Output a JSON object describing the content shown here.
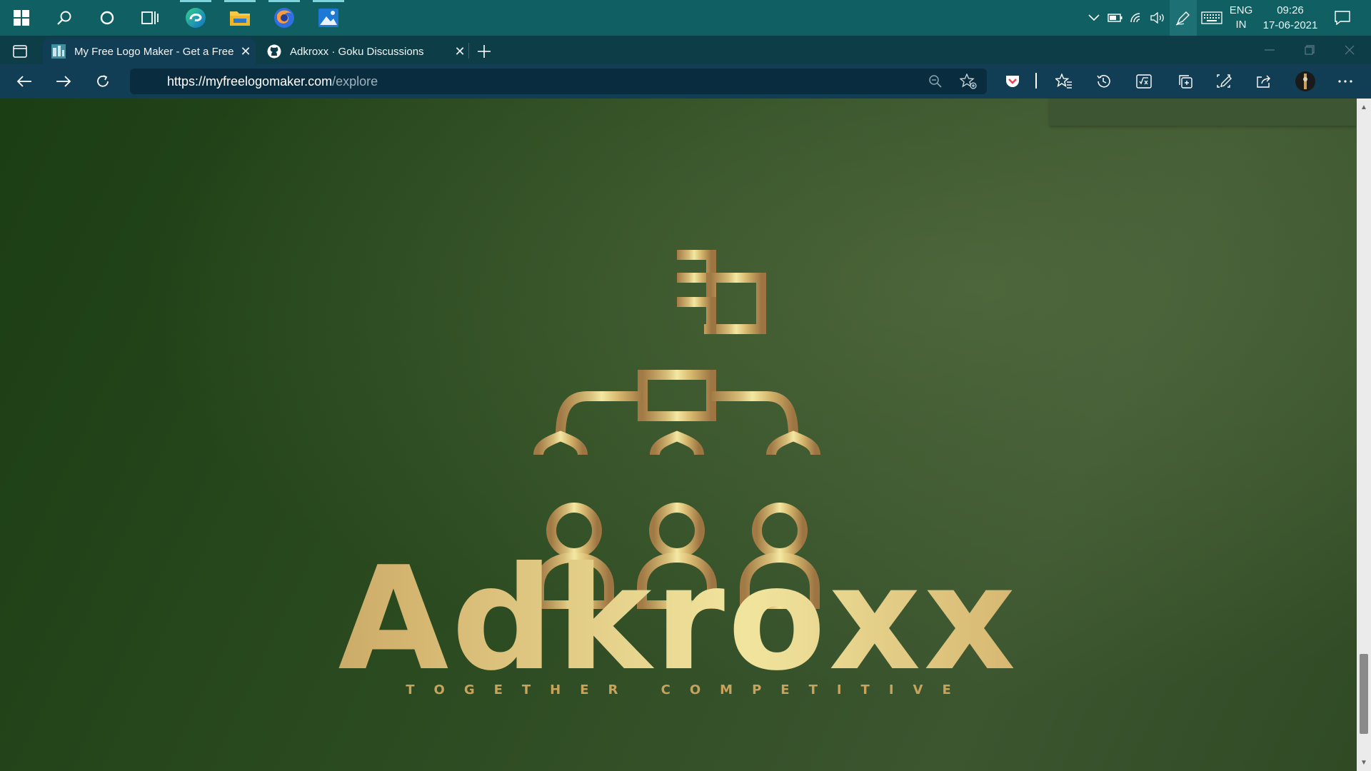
{
  "taskbar": {
    "icons": [
      "windows-start-icon",
      "search-icon",
      "cortana-icon",
      "task-view-icon",
      "edge-icon",
      "file-explorer-icon",
      "firefox-icon",
      "photos-icon"
    ],
    "tray": {
      "language_line1": "ENG",
      "language_line2": "IN",
      "time": "09:26",
      "date": "17-06-2021"
    }
  },
  "browser": {
    "tabs": [
      {
        "title": "My Free Logo Maker - Get a Free Logo",
        "favicon": "myfreelogomaker-favicon",
        "active": true
      },
      {
        "title": "Adkroxx · Goku Discussions",
        "favicon": "github-icon",
        "active": false
      }
    ],
    "address": {
      "domain": "https://myfreelogomaker.com",
      "path": "/explore"
    }
  },
  "page": {
    "brand_name": "Adkroxx",
    "tagline": "TOGETHER  COMPETITIVE",
    "logo_icon": "team-hierarchy-flag-icon"
  },
  "colors": {
    "taskbar_bg": "#0f5f63",
    "tabstrip_bg": "#0d3e48",
    "toolbar_bg": "#113d55",
    "page_green": "#2f4a24",
    "gold_light": "#f1e59e",
    "gold_dark": "#a27a45"
  }
}
